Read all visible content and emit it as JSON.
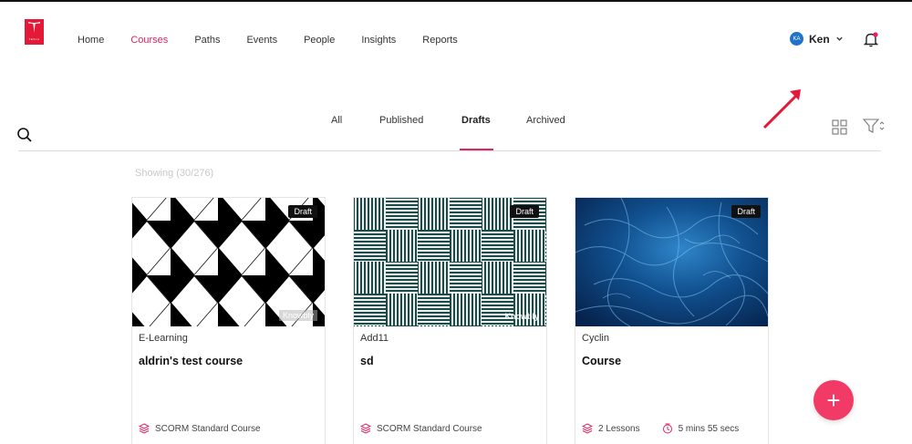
{
  "brand": {
    "accent": "#e0245e",
    "logo_color": "#e31937",
    "logo_text": "TESLA"
  },
  "nav": {
    "items": [
      {
        "label": "Home",
        "active": false
      },
      {
        "label": "Courses",
        "active": true
      },
      {
        "label": "Paths",
        "active": false
      },
      {
        "label": "Events",
        "active": false
      },
      {
        "label": "People",
        "active": false
      },
      {
        "label": "Insights",
        "active": false
      },
      {
        "label": "Reports",
        "active": false
      }
    ]
  },
  "user": {
    "initials": "KA",
    "name": "Ken",
    "icon": "chevron-down-icon"
  },
  "notifications": {
    "icon": "bell-icon",
    "has_unread": true
  },
  "tabs": [
    {
      "label": "All",
      "active": false
    },
    {
      "label": "Published",
      "active": false
    },
    {
      "label": "Drafts",
      "active": true
    },
    {
      "label": "Archived",
      "active": false
    }
  ],
  "showing": "Showing (30/276)",
  "cards": [
    {
      "badge": "Draft",
      "watermark": "Knowbly",
      "category": "E-Learning",
      "title": "aldrin's test course",
      "meta": [
        {
          "icon": "layers-icon",
          "text": "SCORM Standard Course"
        }
      ]
    },
    {
      "badge": "Draft",
      "watermark": "Knowbly",
      "category": "Add11",
      "title": "sd",
      "meta": [
        {
          "icon": "layers-icon",
          "text": "SCORM Standard Course"
        }
      ]
    },
    {
      "badge": "Draft",
      "category": "Cyclin",
      "title": "Course",
      "meta": [
        {
          "icon": "layers-icon",
          "text": "2 Lessons"
        },
        {
          "icon": "clock-icon",
          "text": "5 mins 55 secs"
        }
      ]
    }
  ],
  "fab": {
    "label": "+"
  }
}
